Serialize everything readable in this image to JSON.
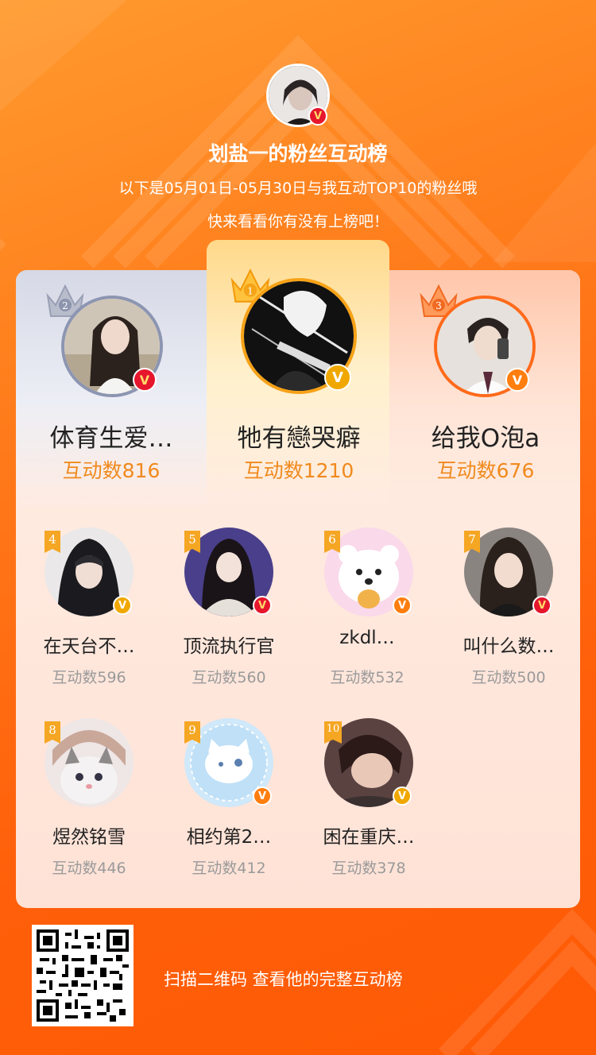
{
  "header": {
    "title": "划盐一的粉丝互动榜",
    "subtitle_line1": "以下是05月01日-05月30日与我互动TOP10的粉丝哦",
    "subtitle_line2": "快来看看你有没有上榜吧！"
  },
  "podium": [
    {
      "rank": 2,
      "name": "体育生爱…",
      "score": "互动数816",
      "badge": "V",
      "accent": "#9fa6be"
    },
    {
      "rank": 1,
      "name": "牠有戀哭癖",
      "score": "互动数1210",
      "badge": "V",
      "accent": "#f6a217"
    },
    {
      "rank": 3,
      "name": "给我O泡a",
      "score": "互动数676",
      "badge": "V",
      "accent": "#ff6a1a"
    }
  ],
  "ranking_list": [
    {
      "rank": "4",
      "name": "在天台不…",
      "score": "互动数596"
    },
    {
      "rank": "5",
      "name": "顶流执行官",
      "score": "互动数560"
    },
    {
      "rank": "6",
      "name": "zkdl…",
      "score": "互动数532"
    },
    {
      "rank": "7",
      "name": "叫什么数…",
      "score": "互动数500"
    },
    {
      "rank": "8",
      "name": "煜然铭雪",
      "score": "互动数446"
    },
    {
      "rank": "9",
      "name": "相约第2…",
      "score": "互动数412"
    },
    {
      "rank": "10",
      "name": "困在重庆…",
      "score": "互动数378"
    }
  ],
  "footer": {
    "qr_caption": "扫描二维码 查看他的完整互动榜"
  },
  "colors": {
    "background": "#ff6a12",
    "score_accent": "#f08a1e",
    "verified_red": "#e6162d",
    "verified_orange": "#ff7e0e",
    "verified_gold": "#f0a800"
  }
}
